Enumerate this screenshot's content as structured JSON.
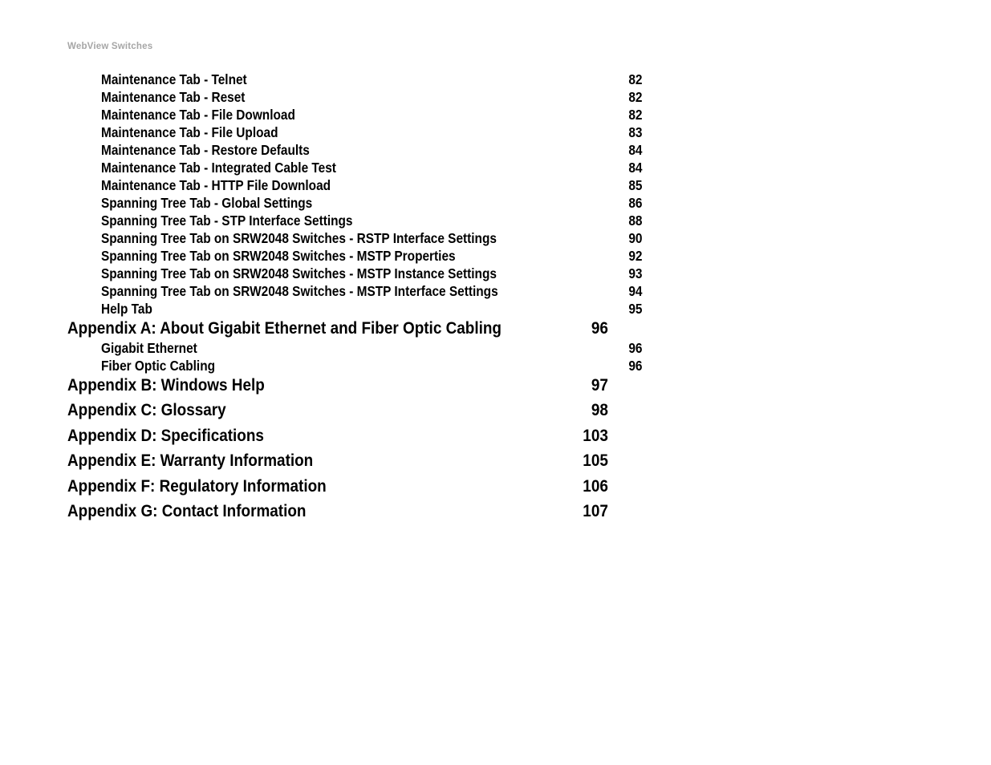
{
  "header": {
    "running_title": "WebView Switches",
    "color": "#a6a6a6"
  },
  "document": {
    "text_color": "#000000",
    "background_color": "#ffffff"
  },
  "toc": {
    "entries": [
      {
        "label": "Maintenance Tab - Telnet",
        "page": "82",
        "level": 2
      },
      {
        "label": "Maintenance Tab - Reset",
        "page": "82",
        "level": 2
      },
      {
        "label": "Maintenance Tab - File Download",
        "page": "82",
        "level": 2
      },
      {
        "label": "Maintenance Tab - File Upload",
        "page": "83",
        "level": 2
      },
      {
        "label": "Maintenance Tab - Restore Defaults",
        "page": "84",
        "level": 2
      },
      {
        "label": "Maintenance Tab - Integrated Cable Test",
        "page": "84",
        "level": 2
      },
      {
        "label": "Maintenance Tab - HTTP File Download",
        "page": "85",
        "level": 2
      },
      {
        "label": "Spanning Tree Tab - Global Settings",
        "page": "86",
        "level": 2
      },
      {
        "label": "Spanning Tree Tab - STP Interface Settings",
        "page": "88",
        "level": 2
      },
      {
        "label": "Spanning Tree Tab on SRW2048 Switches - RSTP Interface Settings",
        "page": "90",
        "level": 2
      },
      {
        "label": "Spanning Tree Tab on SRW2048 Switches - MSTP Properties",
        "page": "92",
        "level": 2
      },
      {
        "label": "Spanning Tree Tab on SRW2048 Switches - MSTP Instance Settings",
        "page": "93",
        "level": 2
      },
      {
        "label": "Spanning Tree Tab on SRW2048 Switches - MSTP Interface Settings",
        "page": "94",
        "level": 2
      },
      {
        "label": "Help Tab",
        "page": "95",
        "level": 2
      },
      {
        "label": "Appendix A: About Gigabit Ethernet and Fiber Optic Cabling",
        "page": "96",
        "level": 1
      },
      {
        "label": "Gigabit Ethernet",
        "page": "96",
        "level": 2
      },
      {
        "label": "Fiber Optic Cabling",
        "page": "96",
        "level": 2
      },
      {
        "label": "Appendix B: Windows Help",
        "page": "97",
        "level": 1
      },
      {
        "label": "Appendix C: Glossary",
        "page": "98",
        "level": 1
      },
      {
        "label": "Appendix D: Specifications",
        "page": "103",
        "level": 1
      },
      {
        "label": "Appendix E: Warranty Information",
        "page": "105",
        "level": 1
      },
      {
        "label": "Appendix F: Regulatory Information",
        "page": "106",
        "level": 1
      },
      {
        "label": "Appendix G: Contact Information",
        "page": "107",
        "level": 1
      }
    ]
  }
}
